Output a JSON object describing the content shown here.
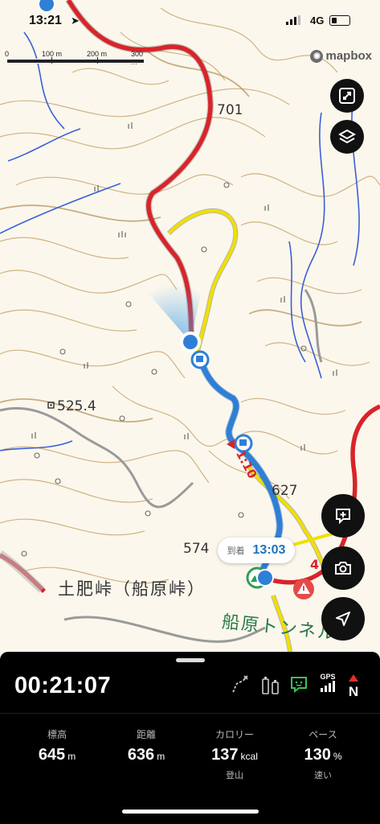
{
  "status_bar": {
    "time": "13:21",
    "network": "4G"
  },
  "map": {
    "scale_labels": [
      "0",
      "100 m",
      "200 m",
      "300 m"
    ],
    "attribution": "mapbox",
    "elevation_labels": [
      "701",
      "525.4",
      "627",
      "574"
    ],
    "place_labels": [
      "土肥峠（船原峠）",
      "船原トンネル"
    ],
    "route_time_label": "1:10",
    "partial_label": "4"
  },
  "eta": {
    "label": "到着",
    "time": "13:03"
  },
  "panel": {
    "elapsed": "00:21:07",
    "status_icons": [
      "route-icon",
      "battery-sensor-icon",
      "chat-icon",
      "gps-icon",
      "north-icon"
    ],
    "gps_text": "GPS",
    "north_text": "N",
    "stats": [
      {
        "label": "標高",
        "value": "645",
        "unit": "m",
        "sub": ""
      },
      {
        "label": "距離",
        "value": "636",
        "unit": "m",
        "sub": ""
      },
      {
        "label": "カロリー",
        "value": "137",
        "unit": "kcal",
        "sub": "登山"
      },
      {
        "label": "ペース",
        "value": "130",
        "unit": "%",
        "sub": "速い"
      }
    ]
  },
  "colors": {
    "route_blue": "#2f7fd6",
    "route_red": "#d8242a",
    "route_yellow": "#f0e000",
    "contour": "#c9a871",
    "water": "#3c5fd8"
  }
}
